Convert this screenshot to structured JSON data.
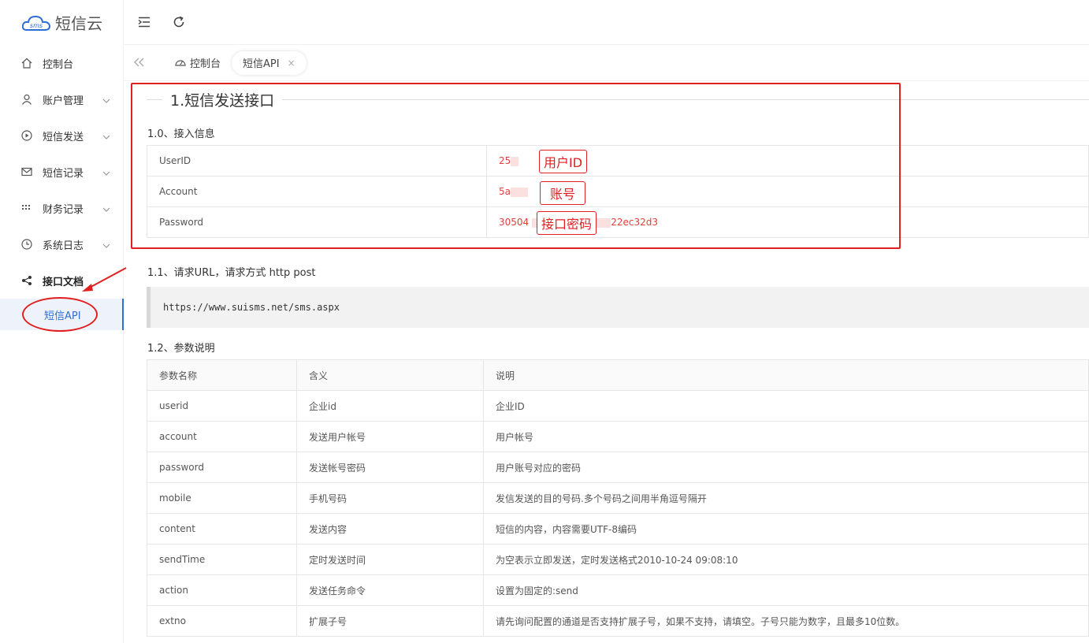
{
  "app": {
    "brand": "短信云",
    "logo_text": "sms"
  },
  "sidebar": {
    "items": [
      {
        "label": "控制台",
        "icon": "home-icon",
        "has_chevron": false
      },
      {
        "label": "账户管理",
        "icon": "user-icon",
        "has_chevron": true
      },
      {
        "label": "短信发送",
        "icon": "play-icon",
        "has_chevron": true
      },
      {
        "label": "短信记录",
        "icon": "mail-icon",
        "has_chevron": true
      },
      {
        "label": "财务记录",
        "icon": "grid-icon",
        "has_chevron": true
      },
      {
        "label": "系统日志",
        "icon": "clock-icon",
        "has_chevron": true
      },
      {
        "label": "接口文档",
        "icon": "share-icon",
        "has_chevron": false
      }
    ],
    "sub_item": "短信API"
  },
  "tabs": [
    {
      "label": "控制台",
      "icon": "dashboard-icon"
    },
    {
      "label": "短信API",
      "close": "×"
    }
  ],
  "section": {
    "title": "1.短信发送接口",
    "info_heading": "1.0、接入信息",
    "info_rows": [
      {
        "key": "UserID",
        "value": "25"
      },
      {
        "key": "Account",
        "value": "5a"
      },
      {
        "key": "Password",
        "value": "30504",
        "value_tail": "22ec32d3"
      }
    ],
    "annotations": {
      "userid": "用户ID",
      "account": "账号",
      "password": "接口密码"
    },
    "url_heading": "1.1、请求URL，请求方式 http post",
    "url": "https://www.suisms.net/sms.aspx",
    "params_heading": "1.2、参数说明",
    "params_header": [
      "参数名称",
      "含义",
      "说明"
    ],
    "params": [
      [
        "userid",
        "企业id",
        "企业ID"
      ],
      [
        "account",
        "发送用户帐号",
        "用户帐号"
      ],
      [
        "password",
        "发送帐号密码",
        "用户账号对应的密码"
      ],
      [
        "mobile",
        "手机号码",
        "发信发送的目的号码.多个号码之间用半角逗号隔开"
      ],
      [
        "content",
        "发送内容",
        "短信的内容，内容需要UTF-8编码"
      ],
      [
        "sendTime",
        "定时发送时间",
        "为空表示立即发送，定时发送格式2010-10-24 09:08:10"
      ],
      [
        "action",
        "发送任务命令",
        "设置为固定的:send"
      ],
      [
        "extno",
        "扩展子号",
        "请先询问配置的通道是否支持扩展子号，如果不支持，请填空。子号只能为数字，且最多10位数。"
      ]
    ]
  }
}
